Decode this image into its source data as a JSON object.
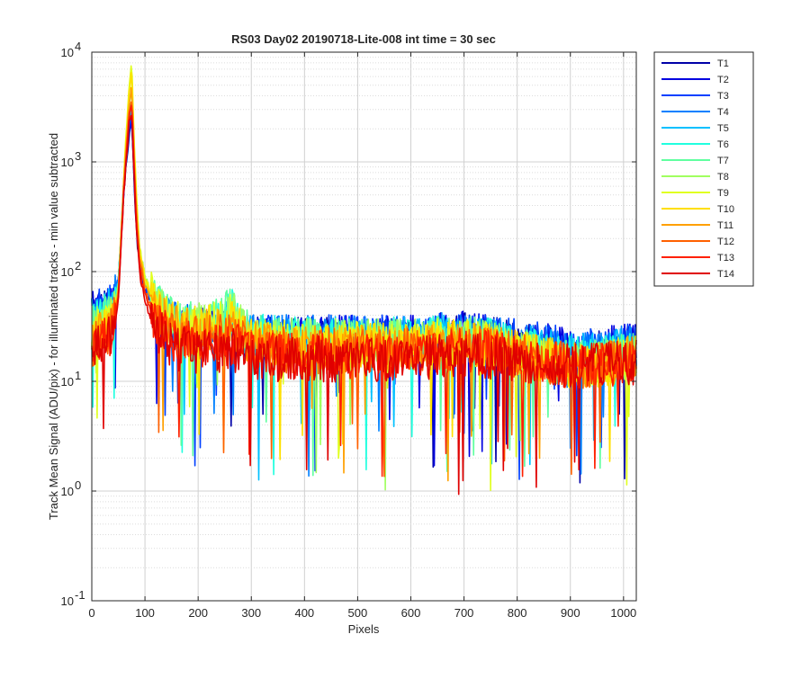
{
  "chart_data": {
    "type": "line",
    "title": "RS03 Day02 20190718-Lite-008 int time = 30 sec",
    "xlabel": "Pixels",
    "ylabel": "Track Mean Signal (ADU/pix) - for illuminated tracks - min value subtracted",
    "xlim": [
      0,
      1024
    ],
    "ylim": [
      0.1,
      10000
    ],
    "yscale": "log",
    "grid": true,
    "minor_grid": true,
    "legend_position": "outside-top-right",
    "x_ticks": [
      "0",
      "100",
      "200",
      "300",
      "400",
      "500",
      "600",
      "700",
      "800",
      "900",
      "1000"
    ],
    "y_ticks": [
      {
        "base": "10",
        "exp": "-1"
      },
      {
        "base": "10",
        "exp": "0"
      },
      {
        "base": "10",
        "exp": "1"
      },
      {
        "base": "10",
        "exp": "2"
      },
      {
        "base": "10",
        "exp": "3"
      },
      {
        "base": "10",
        "exp": "4"
      }
    ],
    "series_profile": {
      "x": [
        0,
        20,
        40,
        50,
        60,
        70,
        75,
        80,
        85,
        90,
        100,
        120,
        150,
        200,
        250,
        265,
        280,
        300,
        400,
        500,
        600,
        700,
        750,
        800,
        850,
        900,
        950,
        1000,
        1024
      ],
      "note_units": "y in ADU/pix, approximate envelope medians read from the log axis"
    },
    "series": [
      {
        "name": "T1",
        "color": "#0000a8",
        "values": [
          40,
          45,
          50,
          80,
          500,
          1800,
          2500,
          600,
          200,
          110,
          70,
          40,
          30,
          28,
          26,
          26,
          25,
          24,
          24,
          24,
          24,
          26,
          24,
          22,
          20,
          18,
          18,
          20,
          20
        ]
      },
      {
        "name": "T2",
        "color": "#0000e0",
        "values": [
          42,
          46,
          52,
          85,
          520,
          1900,
          2600,
          650,
          210,
          115,
          72,
          42,
          32,
          29,
          27,
          27,
          26,
          25,
          25,
          25,
          25,
          27,
          25,
          23,
          21,
          19,
          19,
          21,
          21
        ]
      },
      {
        "name": "T3",
        "color": "#0040ff",
        "values": [
          40,
          44,
          50,
          85,
          540,
          2000,
          2800,
          700,
          220,
          120,
          75,
          44,
          33,
          30,
          28,
          28,
          27,
          26,
          25,
          25,
          25,
          27,
          25,
          23,
          21,
          19,
          19,
          21,
          21
        ]
      },
      {
        "name": "T4",
        "color": "#0080ff",
        "values": [
          38,
          42,
          48,
          85,
          560,
          2200,
          3000,
          760,
          240,
          125,
          78,
          45,
          34,
          30,
          30,
          32,
          28,
          26,
          25,
          25,
          25,
          27,
          24,
          22,
          20,
          18,
          18,
          20,
          20
        ]
      },
      {
        "name": "T5",
        "color": "#00c0ff",
        "values": [
          35,
          40,
          46,
          80,
          580,
          2500,
          3300,
          820,
          260,
          130,
          80,
          46,
          35,
          31,
          32,
          36,
          29,
          26,
          24,
          24,
          24,
          26,
          23,
          21,
          19,
          17,
          17,
          19,
          19
        ]
      },
      {
        "name": "T6",
        "color": "#20ffdf",
        "values": [
          33,
          38,
          44,
          78,
          600,
          2800,
          3800,
          900,
          290,
          140,
          82,
          48,
          36,
          32,
          36,
          45,
          30,
          26,
          24,
          24,
          24,
          25,
          23,
          20,
          18,
          16,
          16,
          18,
          18
        ]
      },
      {
        "name": "T7",
        "color": "#60ffa0",
        "values": [
          30,
          35,
          42,
          75,
          640,
          3500,
          5000,
          1100,
          330,
          150,
          85,
          50,
          37,
          33,
          40,
          55,
          32,
          26,
          23,
          23,
          23,
          25,
          22,
          20,
          17,
          15,
          15,
          17,
          17
        ]
      },
      {
        "name": "T8",
        "color": "#a0ff60",
        "values": [
          28,
          32,
          40,
          72,
          660,
          4500,
          7000,
          1300,
          360,
          160,
          88,
          50,
          36,
          32,
          38,
          50,
          31,
          25,
          23,
          23,
          23,
          24,
          22,
          19,
          16,
          14,
          14,
          16,
          16
        ]
      },
      {
        "name": "T9",
        "color": "#e0ff20",
        "values": [
          26,
          30,
          38,
          70,
          680,
          5000,
          8000,
          1400,
          380,
          165,
          88,
          48,
          35,
          31,
          35,
          42,
          30,
          24,
          22,
          22,
          22,
          24,
          21,
          19,
          16,
          14,
          14,
          16,
          16
        ]
      },
      {
        "name": "T10",
        "color": "#ffdf00",
        "values": [
          25,
          28,
          36,
          68,
          650,
          4200,
          6500,
          1200,
          340,
          150,
          82,
          45,
          33,
          30,
          32,
          36,
          28,
          23,
          21,
          21,
          21,
          23,
          20,
          18,
          16,
          14,
          14,
          16,
          16
        ]
      },
      {
        "name": "T11",
        "color": "#ffa000",
        "values": [
          24,
          27,
          34,
          65,
          620,
          3500,
          5000,
          1000,
          300,
          135,
          76,
          42,
          31,
          28,
          29,
          31,
          26,
          22,
          20,
          20,
          20,
          22,
          20,
          18,
          16,
          14,
          14,
          16,
          16
        ]
      },
      {
        "name": "T12",
        "color": "#ff6000",
        "values": [
          22,
          25,
          32,
          62,
          580,
          2800,
          4000,
          850,
          260,
          120,
          70,
          38,
          28,
          25,
          26,
          27,
          23,
          20,
          19,
          19,
          19,
          21,
          19,
          17,
          15,
          14,
          14,
          16,
          16
        ]
      },
      {
        "name": "T13",
        "color": "#ff2000",
        "values": [
          20,
          23,
          30,
          58,
          540,
          2400,
          3300,
          720,
          220,
          105,
          62,
          34,
          24,
          21,
          21,
          22,
          20,
          18,
          17,
          17,
          17,
          19,
          18,
          16,
          15,
          14,
          14,
          15,
          15
        ]
      },
      {
        "name": "T14",
        "color": "#e00000",
        "values": [
          18,
          21,
          28,
          55,
          500,
          2200,
          3000,
          650,
          200,
          95,
          55,
          30,
          21,
          18,
          18,
          19,
          18,
          16,
          16,
          16,
          16,
          18,
          17,
          16,
          15,
          14,
          14,
          15,
          15
        ]
      }
    ]
  }
}
